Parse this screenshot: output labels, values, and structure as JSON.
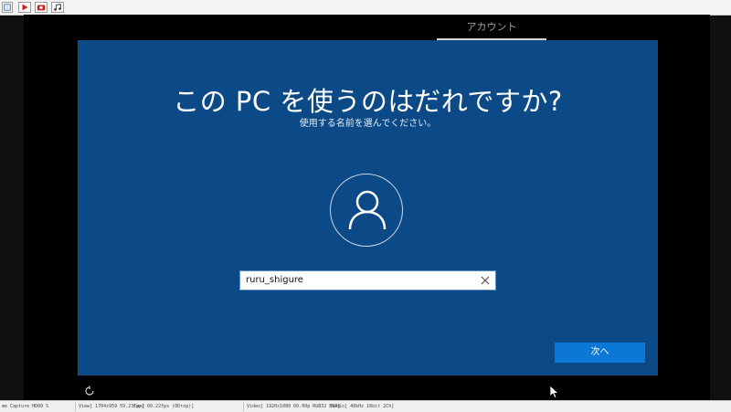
{
  "toolbar": {
    "buttons": [
      {
        "name": "settings",
        "icon": "capture-settings-icon"
      },
      {
        "name": "record",
        "icon": "play-icon"
      },
      {
        "name": "snapshot",
        "icon": "camera-icon"
      },
      {
        "name": "audio",
        "icon": "music-note-icon"
      }
    ],
    "accent_red": "#cc1f1f"
  },
  "oobe": {
    "step_tab": "アカウント",
    "title": "この PC を使うのはだれですか?",
    "subtitle": "使用する名前を選んでください。",
    "username_value": "ruru_shigure",
    "next_label": "次へ",
    "colors": {
      "panel_bg": "#0b4a86",
      "next_button": "#0a78d4"
    }
  },
  "status_bar": {
    "app": "me Capture HD60 S",
    "view": "View[ 1704x959 59.23fps]",
    "capture": "Cap[ 60.22fps (0Drop)]",
    "video": "Video[ 1920x1080 60.00p RGB32 EVR]",
    "audio": "Audio[ 48kHz 16bit 2Ch]"
  }
}
